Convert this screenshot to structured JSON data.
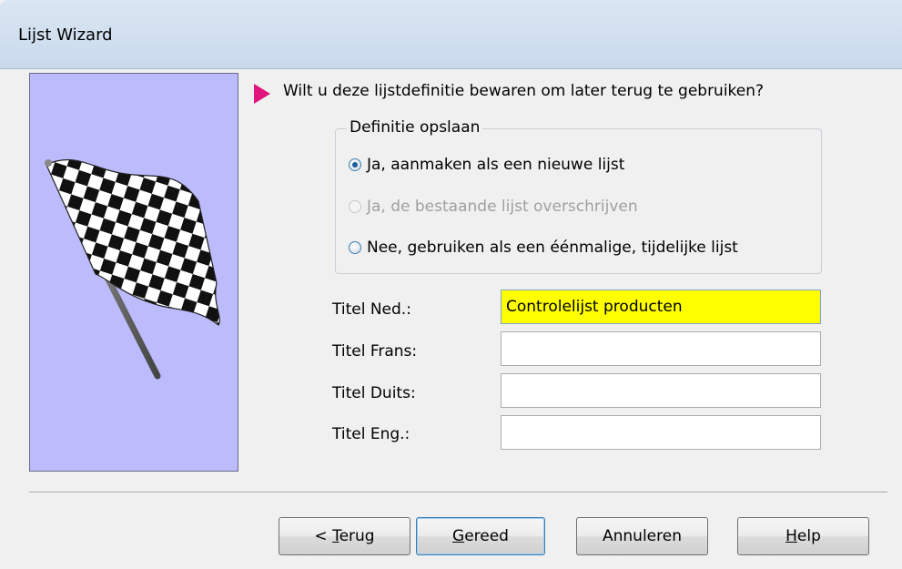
{
  "window": {
    "title": "Lijst Wizard"
  },
  "question": "Wilt u deze lijstdefinitie bewaren om later terug te gebruiken?",
  "group": {
    "legend": "Definitie opslaan",
    "options": [
      {
        "label": "Ja, aanmaken als een nieuwe lijst",
        "checked": true,
        "enabled": true
      },
      {
        "label": "Ja, de bestaande lijst overschrijven",
        "checked": false,
        "enabled": false
      },
      {
        "label": "Nee, gebruiken als een éénmalige, tijdelijke lijst",
        "checked": false,
        "enabled": true
      }
    ]
  },
  "fields": [
    {
      "label": "Titel Ned.:",
      "value": "Controlelijst producten"
    },
    {
      "label": "Titel Frans:",
      "value": ""
    },
    {
      "label": "Titel Duits:",
      "value": ""
    },
    {
      "label": "Titel Eng.:",
      "value": ""
    }
  ],
  "buttons": {
    "back": {
      "prefix": "< ",
      "key": "T",
      "rest": "erug"
    },
    "finish": {
      "key": "G",
      "rest": "ereed"
    },
    "cancel": {
      "label": "Annuleren"
    },
    "help": {
      "key": "H",
      "rest": "elp"
    }
  },
  "illustration": {
    "icon": "checkered-flag-icon",
    "panel_color": "#bcbcfc"
  },
  "colors": {
    "highlight_field": "#ffff00",
    "arrow": "#e0167e"
  }
}
